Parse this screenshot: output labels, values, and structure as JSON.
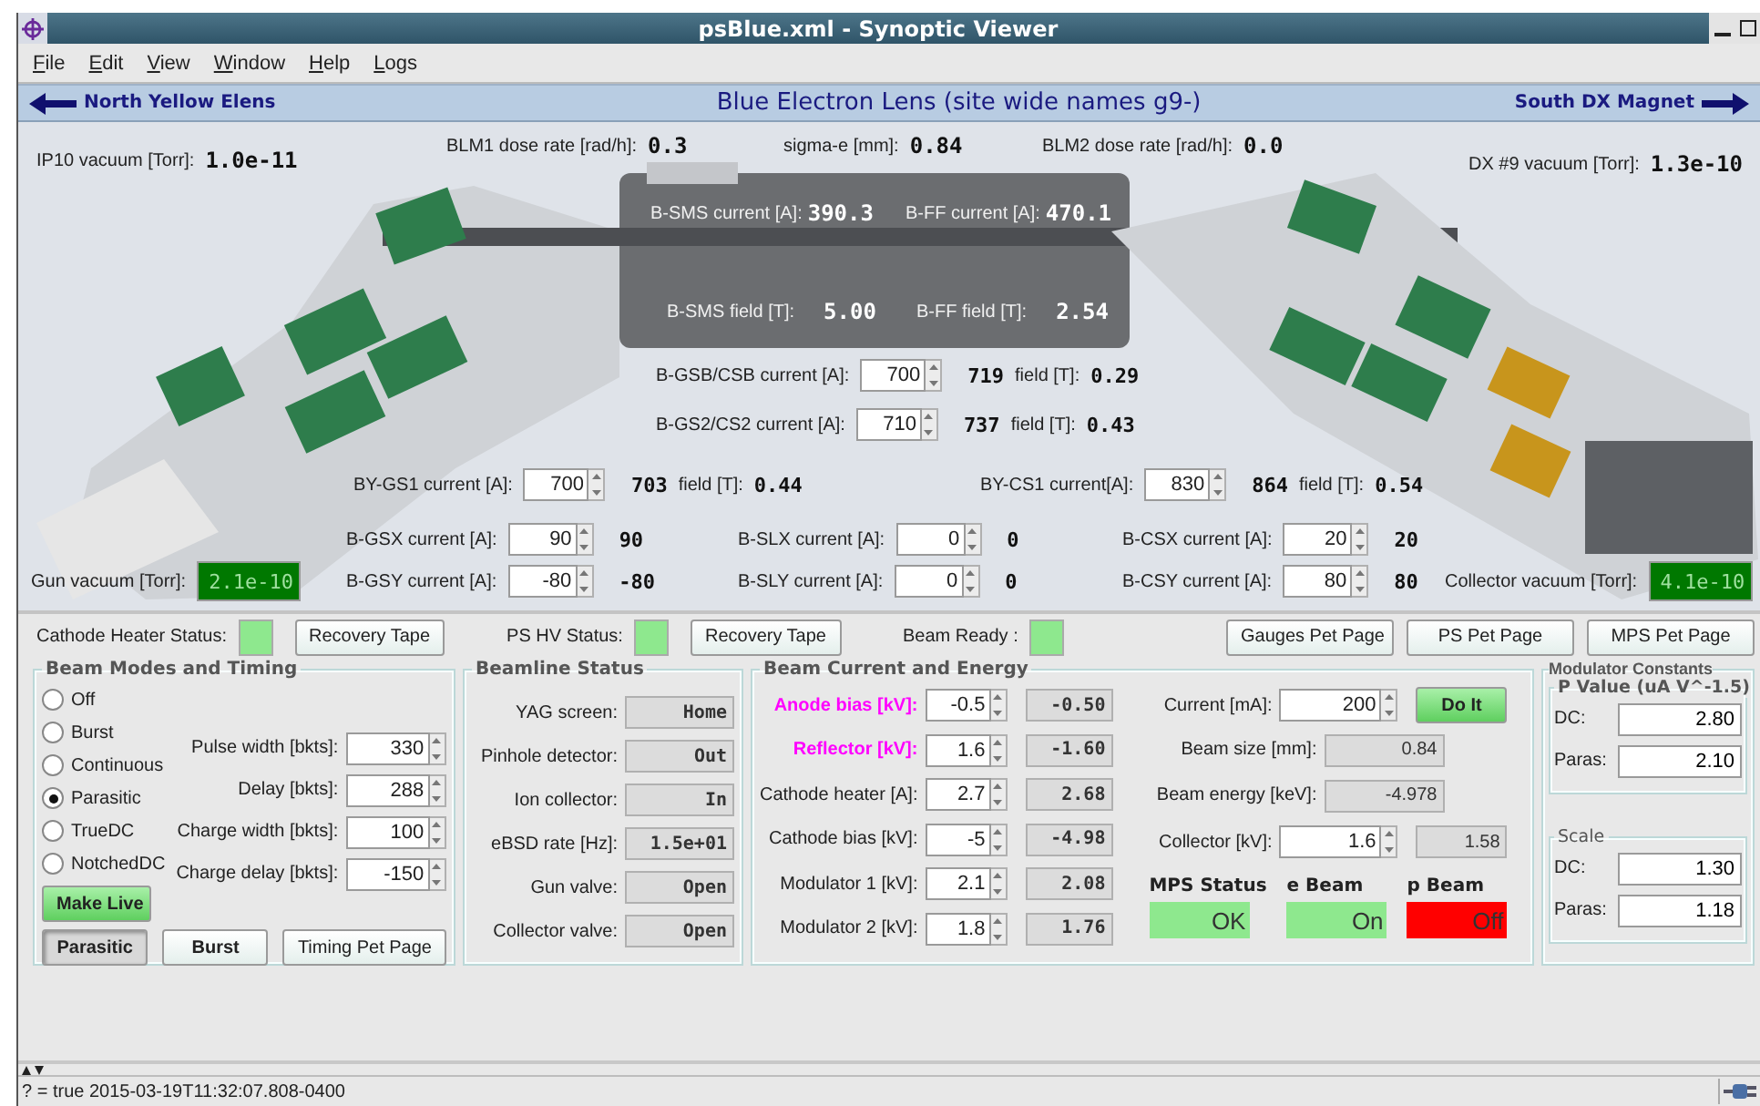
{
  "window": {
    "title": "psBlue.xml - Synoptic Viewer"
  },
  "menu": [
    {
      "label": "File"
    },
    {
      "label": "Edit"
    },
    {
      "label": "View"
    },
    {
      "label": "Window"
    },
    {
      "label": "Help"
    },
    {
      "label": "Logs"
    }
  ],
  "navigation": {
    "previous": "North Yellow Elens",
    "title": "Blue Electron Lens (site wide names g9-)",
    "next": "South DX Magnet"
  },
  "synoptic": {
    "readings": [
      {
        "label": "IP10 vacuum [Torr]:",
        "value": "1.0e-11"
      },
      {
        "label": "BLM1 dose rate [rad/h]:",
        "value": "0.3"
      },
      {
        "label": "sigma-e [mm]:",
        "value": "0.84"
      },
      {
        "label": "BLM2 dose rate [rad/h]:",
        "value": "0.0"
      },
      {
        "label": "DX #9 vacuum [Torr]:",
        "value": "1.3e-10"
      }
    ],
    "solenoid_readings": [
      {
        "label": "B-SMS current [A]:",
        "value": "390.3"
      },
      {
        "label": "B-FF current [A]:",
        "value": "470.1"
      },
      {
        "label": "B-SMS field [T]:",
        "value": "5.00"
      },
      {
        "label": "B-FF field [T]:",
        "value": "2.54"
      }
    ],
    "magnets": [
      {
        "label": "B-GSB/CSB current [A]:",
        "setpoint": "700",
        "readback": "719",
        "field_label": "field [T]:",
        "field": "0.29"
      },
      {
        "label": "B-GS2/CS2 current [A]:",
        "setpoint": "710",
        "readback": "737",
        "field_label": "field [T]:",
        "field": "0.43"
      },
      {
        "label": "BY-GS1 current [A]:",
        "setpoint": "700",
        "readback": "703",
        "field_label": "field [T]:",
        "field": "0.44"
      },
      {
        "label": "BY-CS1 current[A]:",
        "setpoint": "830",
        "readback": "864",
        "field_label": "field [T]:",
        "field": "0.54"
      }
    ],
    "correctors": [
      {
        "label": "B-GSX current [A]:",
        "setpoint": "90",
        "readback": "90"
      },
      {
        "label": "B-GSY current [A]:",
        "setpoint": "-80",
        "readback": "-80"
      },
      {
        "label": "B-SLX current [A]:",
        "setpoint": "0",
        "readback": "0"
      },
      {
        "label": "B-SLY current [A]:",
        "setpoint": "0",
        "readback": "0"
      },
      {
        "label": "B-CSX current [A]:",
        "setpoint": "20",
        "readback": "20"
      },
      {
        "label": "B-CSY current [A]:",
        "setpoint": "80",
        "readback": "80"
      }
    ],
    "vacuum": [
      {
        "label": "Gun vacuum [Torr]:",
        "value": "2.1e-10"
      },
      {
        "label": "Collector vacuum [Torr]:",
        "value": "4.1e-10"
      }
    ]
  },
  "status_row": {
    "items": [
      {
        "kind": "indicator",
        "label": "Cathode Heater Status:",
        "on": true
      },
      {
        "kind": "button",
        "label": "Recovery Tape"
      },
      {
        "kind": "indicator",
        "label": "PS HV Status:",
        "on": true
      },
      {
        "kind": "button",
        "label": "Recovery Tape"
      },
      {
        "kind": "indicator",
        "label": "Beam Ready :",
        "on": true
      }
    ],
    "pages": [
      {
        "label": "Gauges Pet Page"
      },
      {
        "label": "PS Pet Page"
      },
      {
        "label": "MPS Pet Page"
      }
    ]
  },
  "beam_modes": {
    "title": "Beam Modes and Timing",
    "modes": [
      {
        "label": "Off",
        "selected": false
      },
      {
        "label": "Burst",
        "selected": false
      },
      {
        "label": "Continuous",
        "selected": false
      },
      {
        "label": "Parasitic",
        "selected": true
      },
      {
        "label": "TrueDC",
        "selected": false
      },
      {
        "label": "NotchedDC",
        "selected": false
      }
    ],
    "timing": [
      {
        "label": "Pulse width [bkts]:",
        "value": "330"
      },
      {
        "label": "Delay [bkts]:",
        "value": "288"
      },
      {
        "label": "Charge width [bkts]:",
        "value": "100"
      },
      {
        "label": "Charge delay [bkts]:",
        "value": "-150"
      }
    ],
    "buttons": [
      {
        "kind": "action",
        "label": "Make Live"
      },
      {
        "kind": "mode",
        "label": "Parasitic",
        "selected": true
      },
      {
        "kind": "mode",
        "label": "Burst",
        "selected": false
      },
      {
        "kind": "page",
        "label": "Timing Pet Page"
      }
    ]
  },
  "beamline_status": {
    "title": "Beamline Status",
    "items": [
      {
        "label": "YAG screen:",
        "value": "Home"
      },
      {
        "label": "Pinhole detector:",
        "value": "Out"
      },
      {
        "label": "Ion collector:",
        "value": "In"
      },
      {
        "label": "eBSD rate [Hz]:",
        "value": "1.5e+01"
      },
      {
        "label": "Gun valve:",
        "value": "Open"
      },
      {
        "label": "Collector valve:",
        "value": "Open"
      }
    ]
  },
  "beam_current": {
    "title": "Beam Current and Energy",
    "settings": [
      {
        "label": "Anode bias [kV]:",
        "setpoint": "-0.5",
        "readback": "-0.50",
        "highlight": true
      },
      {
        "label": "Reflector [kV]:",
        "setpoint": "1.6",
        "readback": "-1.60",
        "highlight": true
      },
      {
        "label": "Cathode heater [A]:",
        "setpoint": "2.7",
        "readback": "2.68",
        "highlight": false
      },
      {
        "label": "Cathode bias [kV]:",
        "setpoint": "-5",
        "readback": "-4.98",
        "highlight": false
      },
      {
        "label": "Modulator 1 [kV]:",
        "setpoint": "2.1",
        "readback": "2.08",
        "highlight": false
      },
      {
        "label": "Modulator 2 [kV]:",
        "setpoint": "1.8",
        "readback": "1.76",
        "highlight": false
      }
    ],
    "current": {
      "label": "Current [mA]:",
      "value": "200",
      "button": "Do It"
    },
    "beam_size": {
      "label": "Beam size [mm]:",
      "value": "0.84"
    },
    "beam_energy": {
      "label": "Beam energy [keV]:",
      "value": "-4.978"
    },
    "collector": {
      "label": "Collector [kV]:",
      "setpoint": "1.6",
      "readback": "1.58"
    },
    "status": [
      {
        "label": "MPS Status",
        "value": "OK",
        "color": "#8ee88e"
      },
      {
        "label": "e Beam",
        "value": "On",
        "color": "#8ee88e"
      },
      {
        "label": "p Beam",
        "value": "Off",
        "color": "#ff0000"
      }
    ]
  },
  "modulator_constants": {
    "title": "Modulator Constants",
    "groups": [
      {
        "title": "P Value (uA V^-1.5)",
        "fields": [
          {
            "label": "DC:",
            "value": "2.80"
          },
          {
            "label": "Paras:",
            "value": "2.10"
          }
        ]
      },
      {
        "title": "Scale",
        "fields": [
          {
            "label": "DC:",
            "value": "1.30"
          },
          {
            "label": "Paras:",
            "value": "1.18"
          }
        ]
      }
    ]
  },
  "status_bar": {
    "text": "? = true 2015-03-19T11:32:07.808-0400"
  }
}
